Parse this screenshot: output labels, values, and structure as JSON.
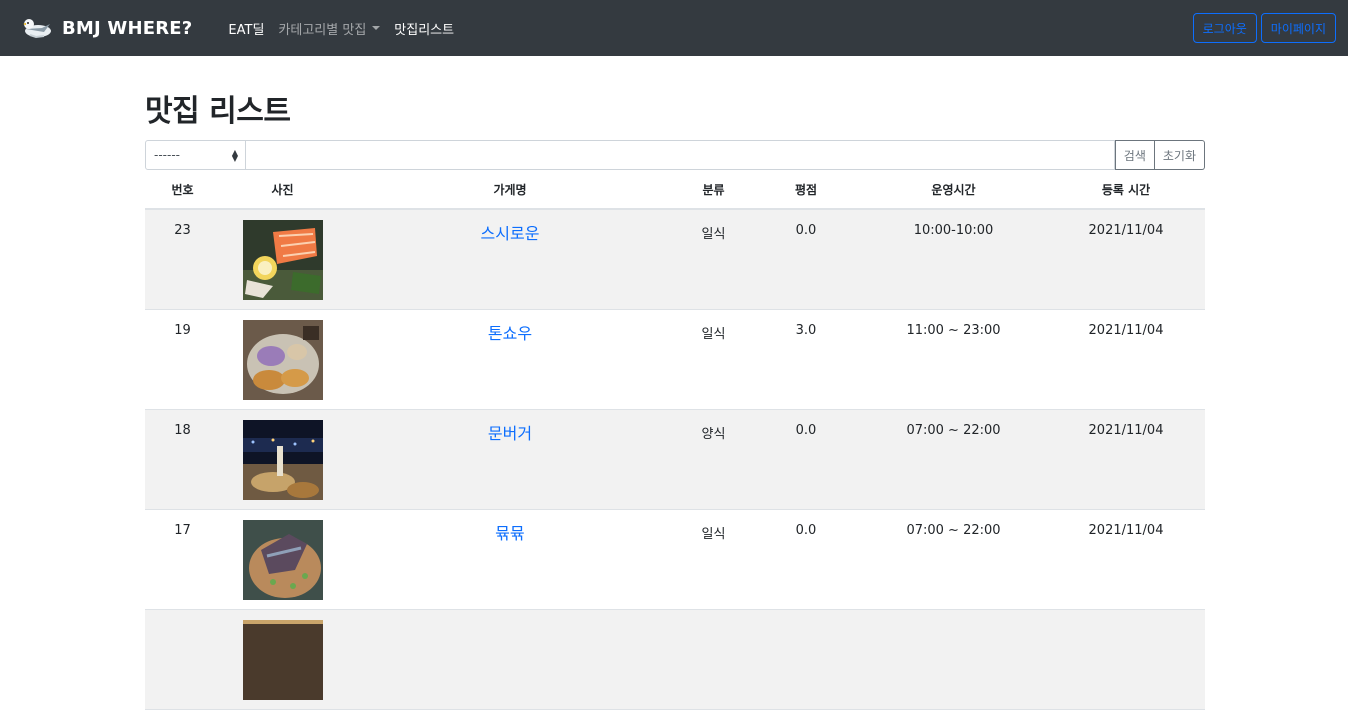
{
  "navbar": {
    "brand": "BMJ WHERE?",
    "links": [
      {
        "label": "EAT딜"
      },
      {
        "label": "카테고리별 맛집"
      },
      {
        "label": "맛집리스트"
      }
    ],
    "logout": "로그아웃",
    "mypage": "마이페이지"
  },
  "page": {
    "title": "맛집 리스트"
  },
  "search": {
    "select_value": "------",
    "search_button": "검색",
    "reset_button": "초기화"
  },
  "table": {
    "headers": [
      "번호",
      "사진",
      "가게명",
      "분류",
      "평점",
      "운영시간",
      "등록 시간"
    ],
    "rows": [
      {
        "id": "23",
        "name": "스시로운",
        "category": "일식",
        "rating": "0.0",
        "hours": "10:00-10:00",
        "registered": "2021/11/04"
      },
      {
        "id": "19",
        "name": "톤쇼우",
        "category": "일식",
        "rating": "3.0",
        "hours": "11:00 ~ 23:00",
        "registered": "2021/11/04"
      },
      {
        "id": "18",
        "name": "문버거",
        "category": "양식",
        "rating": "0.0",
        "hours": "07:00 ~ 22:00",
        "registered": "2021/11/04"
      },
      {
        "id": "17",
        "name": "뮦뮦",
        "category": "일식",
        "rating": "0.0",
        "hours": "07:00 ~ 22:00",
        "registered": "2021/11/04"
      }
    ]
  },
  "colors": {
    "navbar_bg": "#343a40",
    "link_blue": "#0d6efd",
    "stripe": "#f2f2f2"
  }
}
